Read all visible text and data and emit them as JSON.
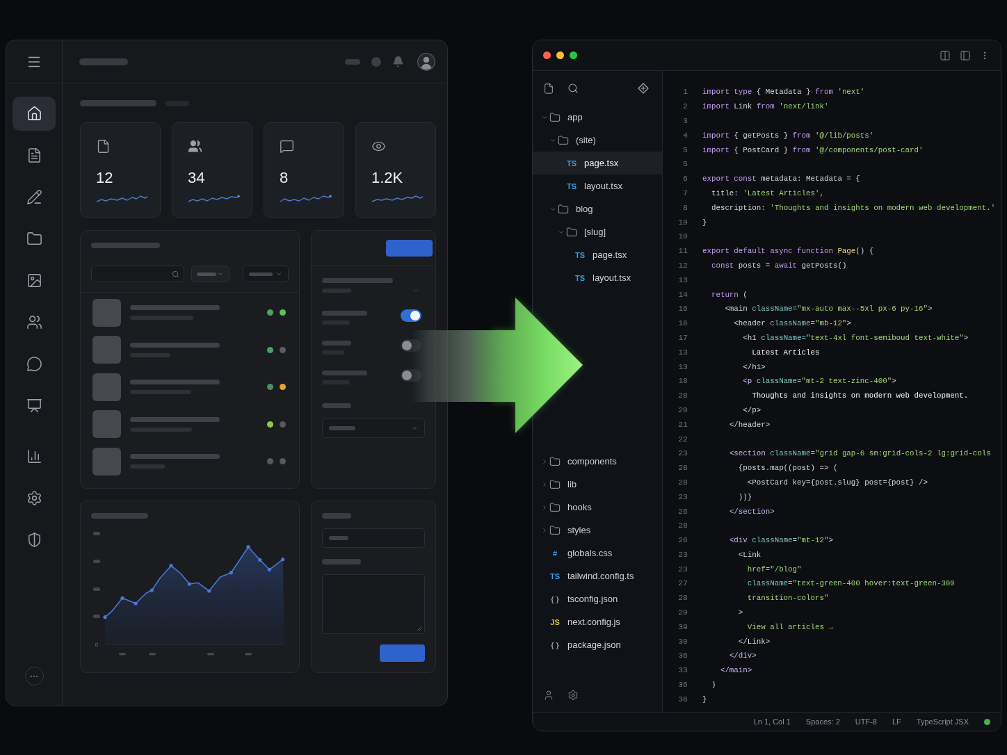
{
  "dashboard": {
    "nav_sections": [
      {
        "items": [
          {
            "selected": true
          },
          {
            "selected": false
          },
          {
            "selected": false
          },
          {
            "selected": false
          },
          {
            "selected": false
          },
          {
            "selected": false
          },
          {
            "selected": false
          },
          {
            "selected": false
          }
        ]
      },
      {
        "items": [
          {
            "selected": false
          },
          {
            "selected": false
          },
          {
            "selected": false
          }
        ]
      }
    ],
    "stats": [
      {
        "value": "12"
      },
      {
        "value": "34"
      },
      {
        "value": "8"
      },
      {
        "value": "1.2K"
      }
    ],
    "list_rows": [
      {
        "status_dots": [
          {
            "color": "#4f9e63"
          },
          {
            "color": "#5cc25a"
          }
        ]
      },
      {
        "status_dots": [
          {
            "color": "#4f9e63"
          },
          {
            "color": "#5a5d62"
          }
        ]
      },
      {
        "status_dots": [
          {
            "color": "#4a8f66"
          },
          {
            "color": "#e0a82e"
          }
        ]
      },
      {
        "status_dots": [
          {
            "color": "#8cc84b"
          },
          {
            "color": "#55585d"
          }
        ]
      },
      {
        "status_dots": [
          {
            "color": "#55585d"
          },
          {
            "color": "#55585d"
          }
        ]
      }
    ],
    "toggles": [
      {
        "on": true
      },
      {
        "on": false
      },
      {
        "on": false
      }
    ],
    "chart": {
      "baseline_label": "0"
    }
  },
  "editor": {
    "file_tree": [
      {
        "kind": "folder",
        "name": "app",
        "expanded": true,
        "selected": false,
        "children": [
          {
            "kind": "folder",
            "name": "(site)",
            "expanded": true,
            "selected": false,
            "children": [
              {
                "kind": "file",
                "badge": "TS",
                "color": "#3b9be0",
                "name": "page.tsx",
                "selected": true
              },
              {
                "kind": "file",
                "badge": "TS",
                "color": "#3b9be0",
                "name": "layout.tsx",
                "selected": false
              }
            ]
          },
          {
            "kind": "folder",
            "name": "blog",
            "expanded": true,
            "selected": false,
            "children": [
              {
                "kind": "folder",
                "name": "[slug]",
                "expanded": true,
                "selected": false,
                "children": [
                  {
                    "kind": "file",
                    "badge": "TS",
                    "color": "#3b9be0",
                    "name": "page.tsx",
                    "selected": false
                  },
                  {
                    "kind": "file",
                    "badge": "TS",
                    "color": "#3b9be0",
                    "name": "layout.tsx",
                    "selected": false
                  }
                ]
              }
            ]
          }
        ]
      },
      {
        "kind": "folder",
        "name": "components",
        "expanded": false,
        "selected": false
      },
      {
        "kind": "folder",
        "name": "lib",
        "expanded": false,
        "selected": false
      },
      {
        "kind": "folder",
        "name": "hooks",
        "expanded": false,
        "selected": false
      },
      {
        "kind": "folder",
        "name": "styles",
        "expanded": false,
        "selected": false
      },
      {
        "kind": "file",
        "badge": "#",
        "color": "#3b9be0",
        "name": "globals.css",
        "selected": false
      },
      {
        "kind": "file",
        "badge": "TS",
        "color": "#3b9be0",
        "name": "tailwind.config.ts",
        "selected": false
      },
      {
        "kind": "file",
        "badge": "{ }",
        "color": "#8e9297",
        "name": "tsconfig.json",
        "selected": false
      },
      {
        "kind": "file",
        "badge": "JS",
        "color": "#cfc14a",
        "name": "next.config.js",
        "selected": false
      },
      {
        "kind": "file",
        "badge": "{ }",
        "color": "#8e9297",
        "name": "package.json",
        "selected": false
      }
    ],
    "code_lines": [
      {
        "number": "1",
        "tokens": [
          {
            "kind": "kw",
            "text": "import type"
          },
          {
            "kind": "plain",
            "text": " { Metadata } "
          },
          {
            "kind": "kw",
            "text": "from "
          },
          {
            "kind": "str",
            "text": "'next'"
          }
        ]
      },
      {
        "number": "2",
        "tokens": [
          {
            "kind": "kw",
            "text": "import"
          },
          {
            "kind": "plain",
            "text": " Link "
          },
          {
            "kind": "kw",
            "text": "from "
          },
          {
            "kind": "str",
            "text": "'next/link'"
          }
        ]
      },
      {
        "number": "3"
      },
      {
        "number": "4",
        "tokens": [
          {
            "kind": "kw",
            "text": "import"
          },
          {
            "kind": "plain",
            "text": " { getPosts } "
          },
          {
            "kind": "kw",
            "text": "from "
          },
          {
            "kind": "str",
            "text": "'@/lib/posts'"
          }
        ]
      },
      {
        "number": "5",
        "tokens": [
          {
            "kind": "kw",
            "text": "import"
          },
          {
            "kind": "plain",
            "text": " { PostCard } "
          },
          {
            "kind": "kw",
            "text": "from "
          },
          {
            "kind": "str",
            "text": "'@/components/post-card'"
          }
        ]
      },
      {
        "number": "5"
      },
      {
        "number": "6",
        "tokens": [
          {
            "kind": "kw",
            "text": "export const"
          },
          {
            "kind": "plain",
            "text": " metadata: Metadata = {"
          }
        ]
      },
      {
        "number": "7",
        "tokens": [
          {
            "kind": "plain",
            "text": "  title: "
          },
          {
            "kind": "str",
            "text": "'Latest Articles'"
          },
          {
            "kind": "plain",
            "text": ","
          }
        ]
      },
      {
        "number": "8",
        "tokens": [
          {
            "kind": "plain",
            "text": "  description: "
          },
          {
            "kind": "str",
            "text": "'Thoughts and insights on modern web development.'"
          }
        ]
      },
      {
        "number": "19",
        "tokens": [
          {
            "kind": "plain",
            "text": "}"
          }
        ]
      },
      {
        "number": "10"
      },
      {
        "number": "11",
        "tokens": [
          {
            "kind": "kw",
            "text": "export default async function "
          },
          {
            "kind": "fn",
            "text": "Page"
          },
          {
            "kind": "plain",
            "text": "() {"
          }
        ]
      },
      {
        "number": "12",
        "tokens": [
          {
            "kind": "kw",
            "text": "  const"
          },
          {
            "kind": "plain",
            "text": " posts = "
          },
          {
            "kind": "kw",
            "text": "await"
          },
          {
            "kind": "plain",
            "text": " getPosts()"
          }
        ]
      },
      {
        "number": "13"
      },
      {
        "number": "14",
        "tokens": [
          {
            "kind": "kw",
            "text": "  return"
          },
          {
            "kind": "plain",
            "text": " ("
          }
        ]
      },
      {
        "number": "16",
        "tokens": [
          {
            "kind": "plain",
            "text": "     <main "
          },
          {
            "kind": "attr",
            "text": "className="
          },
          {
            "kind": "str",
            "text": "\"mx-auto max--5xl px-6 py-16\""
          },
          {
            "kind": "plain",
            "text": ">"
          }
        ]
      },
      {
        "number": "16",
        "tokens": [
          {
            "kind": "plain",
            "text": "       <header "
          },
          {
            "kind": "attr",
            "text": "className="
          },
          {
            "kind": "str",
            "text": "\"mb-12\""
          },
          {
            "kind": "plain",
            "text": ">"
          }
        ]
      },
      {
        "number": "17",
        "tokens": [
          {
            "kind": "plain",
            "text": "         <h1 "
          },
          {
            "kind": "attr",
            "text": "className="
          },
          {
            "kind": "str",
            "text": "\"text-4xl font-semiboud text-white\""
          },
          {
            "kind": "plain",
            "text": ">"
          }
        ]
      },
      {
        "number": "13",
        "tokens": [
          {
            "kind": "text",
            "text": "           Latest Articles"
          }
        ]
      },
      {
        "number": "13",
        "tokens": [
          {
            "kind": "plain",
            "text": "         </h1>"
          }
        ]
      },
      {
        "number": "18",
        "tokens": [
          {
            "kind": "tag",
            "text": "         <p "
          },
          {
            "kind": "attr",
            "text": "className="
          },
          {
            "kind": "str",
            "text": "\"mt-2 text-zinc-400\""
          },
          {
            "kind": "plain",
            "text": ">"
          }
        ]
      },
      {
        "number": "28",
        "tokens": [
          {
            "kind": "text",
            "text": "           Thoughts and insights on modern web development."
          }
        ]
      },
      {
        "number": "20",
        "tokens": [
          {
            "kind": "plain",
            "text": "         </p>"
          }
        ]
      },
      {
        "number": "21",
        "tokens": [
          {
            "kind": "plain",
            "text": "      </header>"
          }
        ]
      },
      {
        "number": "22"
      },
      {
        "number": "23",
        "tokens": [
          {
            "kind": "tag",
            "text": "      <section "
          },
          {
            "kind": "attr",
            "text": "className="
          },
          {
            "kind": "str",
            "text": "\"grid gap-6 sm:grid-cols-2 lg:grid-cols"
          }
        ]
      },
      {
        "number": "28",
        "tokens": [
          {
            "kind": "plain",
            "text": "        {posts.map((post) => ("
          }
        ]
      },
      {
        "number": "28",
        "tokens": [
          {
            "kind": "plain",
            "text": "          <PostCard key={post.slug} post={post} />"
          }
        ]
      },
      {
        "number": "23",
        "tokens": [
          {
            "kind": "plain",
            "text": "        ))}"
          }
        ]
      },
      {
        "number": "26",
        "tokens": [
          {
            "kind": "tag",
            "text": "      </section>"
          }
        ]
      },
      {
        "number": "28"
      },
      {
        "number": "26",
        "tokens": [
          {
            "kind": "tag",
            "text": "      <div "
          },
          {
            "kind": "attr",
            "text": "className="
          },
          {
            "kind": "str",
            "text": "\"mt-12\""
          },
          {
            "kind": "plain",
            "text": ">"
          }
        ]
      },
      {
        "number": "23",
        "tokens": [
          {
            "kind": "plain",
            "text": "        <Link"
          }
        ]
      },
      {
        "number": "23",
        "tokens": [
          {
            "kind": "str",
            "text": "          href=\"/blog\""
          }
        ]
      },
      {
        "number": "27",
        "tokens": [
          {
            "kind": "attr",
            "text": "          className="
          },
          {
            "kind": "str",
            "text": "\"text-green-400 hover:text-green-300"
          }
        ]
      },
      {
        "number": "28",
        "tokens": [
          {
            "kind": "str",
            "text": "          transition-colors\""
          }
        ]
      },
      {
        "number": "20",
        "tokens": [
          {
            "kind": "plain",
            "text": "        >"
          }
        ]
      },
      {
        "number": "39",
        "tokens": [
          {
            "kind": "str",
            "text": "          View all articles →"
          }
        ]
      },
      {
        "number": "30",
        "tokens": [
          {
            "kind": "plain",
            "text": "        </Link>"
          }
        ]
      },
      {
        "number": "36",
        "tokens": [
          {
            "kind": "tag",
            "text": "      </div>"
          }
        ]
      },
      {
        "number": "33",
        "tokens": [
          {
            "kind": "tag",
            "text": "    </main>"
          }
        ]
      },
      {
        "number": "36",
        "tokens": [
          {
            "kind": "plain",
            "text": "  )"
          }
        ]
      },
      {
        "number": "36",
        "tokens": [
          {
            "kind": "plain",
            "text": "}"
          }
        ]
      }
    ],
    "status_bar": [
      "Ln 1, Col 1",
      "Spaces: 2",
      "UTF-8",
      "LF",
      "TypeScript JSX"
    ]
  }
}
